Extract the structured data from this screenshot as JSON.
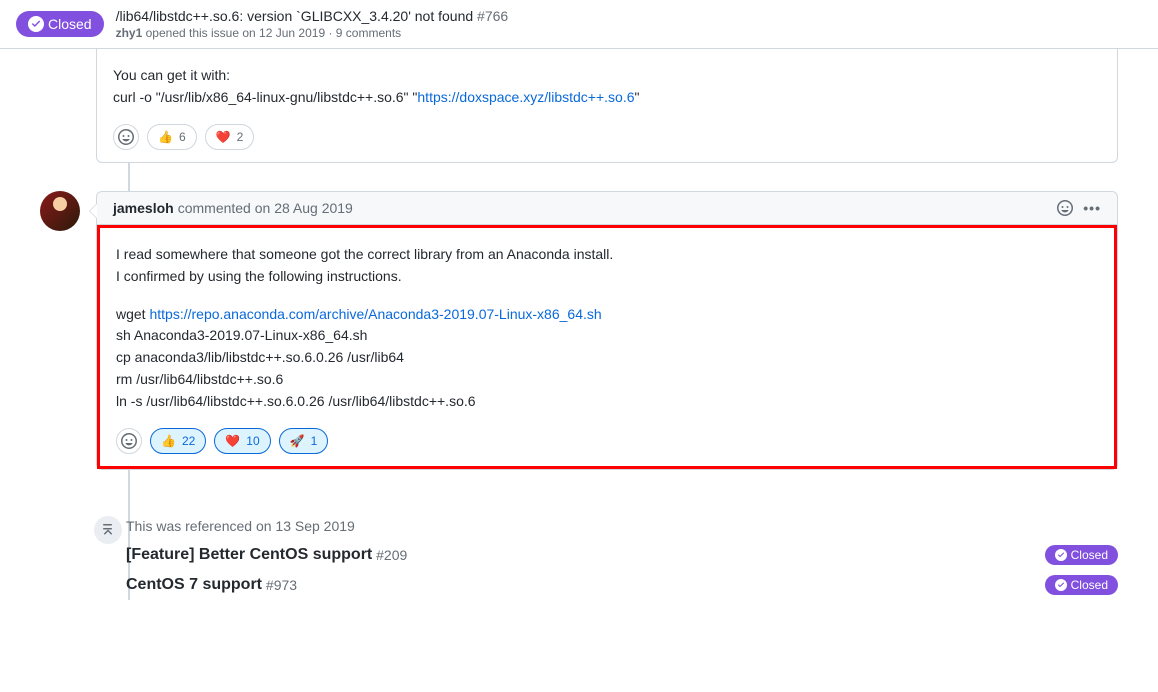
{
  "header": {
    "status": "Closed",
    "title": "/lib64/libstdc++.so.6: version `GLIBCXX_3.4.20' not found",
    "issue_number": "#766",
    "author": "zhy1",
    "opened_text": "opened this issue",
    "date": "on 12 Jun 2019",
    "comments": "9 comments"
  },
  "comment1": {
    "body_line1": "You can get it with:",
    "body_line2_prefix": "curl -o \"/usr/lib/x86_64-linux-gnu/libstdc++.so.6\" \"",
    "body_line2_link": "https://doxspace.xyz/libstdc++.so.6",
    "body_line2_suffix": "\"",
    "reactions": {
      "thumbs_emoji": "👍",
      "thumbs_count": "6",
      "heart_emoji": "❤️",
      "heart_count": "2"
    }
  },
  "comment2": {
    "author": "jamesloh",
    "commented_text": "commented",
    "date": "on 28 Aug 2019",
    "body_p1_line1": "I read somewhere that someone got the correct library from an Anaconda install.",
    "body_p1_line2": "I confirmed by using the following instructions.",
    "body_p2_wget": "wget ",
    "body_p2_link": "https://repo.anaconda.com/archive/Anaconda3-2019.07-Linux-x86_64.sh",
    "body_p2_line2": "sh Anaconda3-2019.07-Linux-x86_64.sh",
    "body_p2_line3": "cp anaconda3/lib/libstdc++.so.6.0.26 /usr/lib64",
    "body_p2_line4": "rm /usr/lib64/libstdc++.so.6",
    "body_p2_line5": "ln -s /usr/lib64/libstdc++.so.6.0.26 /usr/lib64/libstdc++.so.6",
    "reactions": {
      "thumbs_emoji": "👍",
      "thumbs_count": "22",
      "heart_emoji": "❤️",
      "heart_count": "10",
      "rocket_emoji": "🚀",
      "rocket_count": "1"
    }
  },
  "references": {
    "intro": "This was referenced",
    "date": "on 13 Sep 2019",
    "items": [
      {
        "title": "[Feature] Better CentOS support",
        "num": "#209",
        "status": "Closed"
      },
      {
        "title": "CentOS 7 support",
        "num": "#973",
        "status": "Closed"
      }
    ]
  }
}
